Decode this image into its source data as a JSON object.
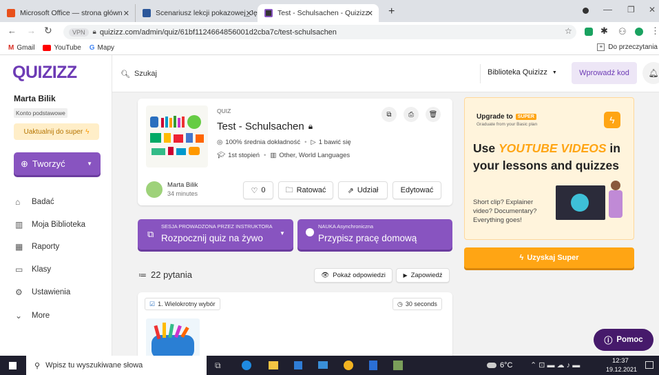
{
  "browser": {
    "tabs": [
      {
        "title": "Microsoft Office — strona główn"
      },
      {
        "title": "Scenariusz lekcji pokazowej_Języ"
      },
      {
        "title": "Test - Schulsachen - Quizizz"
      }
    ],
    "url": "quizizz.com/admin/quiz/61bf1124664856001d2cba7c/test-schulsachen",
    "bookmarks": [
      "Gmail",
      "YouTube",
      "Mapy"
    ],
    "reading_list": "Do przeczytania"
  },
  "sidebar": {
    "logo": "QUIZIZZ",
    "user_name": "Marta Bilik",
    "account_type": "Konto podstawowe",
    "upgrade_label": "Uaktualnij do super",
    "create_label": "Tworzyć",
    "nav": [
      "Badać",
      "Moja Biblioteka",
      "Raporty",
      "Klasy",
      "Ustawienia",
      "More"
    ]
  },
  "topbar": {
    "search_placeholder": "Szukaj",
    "library_label": "Biblioteka Quizizz",
    "enter_code_label": "Wprowadź kod"
  },
  "quiz": {
    "type_label": "QUIZ",
    "title": "Test - Schulsachen",
    "accuracy": "100% średnia dokładność",
    "plays": "1 bawić się",
    "grade": "1st stopień",
    "subjects": "Other,  World Languages",
    "author": "Marta Bilik",
    "time_ago": "34 minutes",
    "likes": "0",
    "save_label": "Ratować",
    "share_label": "Udział",
    "edit_label": "Edytować"
  },
  "actions": {
    "live_small": "SESJA PROWADZONA PRZEZ INSTRUKTORA",
    "live_big": "Rozpocznij quiz na żywo",
    "hw_small": "NAUKA Asynchroniczna",
    "hw_big": "Przypisz pracę domową"
  },
  "questions": {
    "count_label": "22 pytania",
    "show_answers": "Pokaż odpowiedzi",
    "preview": "Zapowiedź",
    "first_type": "1. Wielokrotny wybór",
    "first_time": "30 seconds"
  },
  "promo": {
    "upgrade_to": "Upgrade to",
    "super_badge": "SUPER",
    "subline": "Graduate from your Basic plan",
    "headline_pre": "Use",
    "headline_hl": "YOUTUBE VIDEOS",
    "headline_post": "in your lessons and quizzes",
    "body": "Short clip? Explainer video? Documentary? Everything goes!",
    "cta": "Uzyskaj Super"
  },
  "help_label": "Pomoc",
  "taskbar": {
    "search_placeholder": "Wpisz tu wyszukiwane słowa",
    "weather": "6°C",
    "time": "12:37",
    "date": "19.12.2021"
  },
  "colors": {
    "brand": "#8854c0",
    "promo_bg": "#fff4dc",
    "promo_accent": "#ffa514",
    "cta": "#ffa514"
  }
}
